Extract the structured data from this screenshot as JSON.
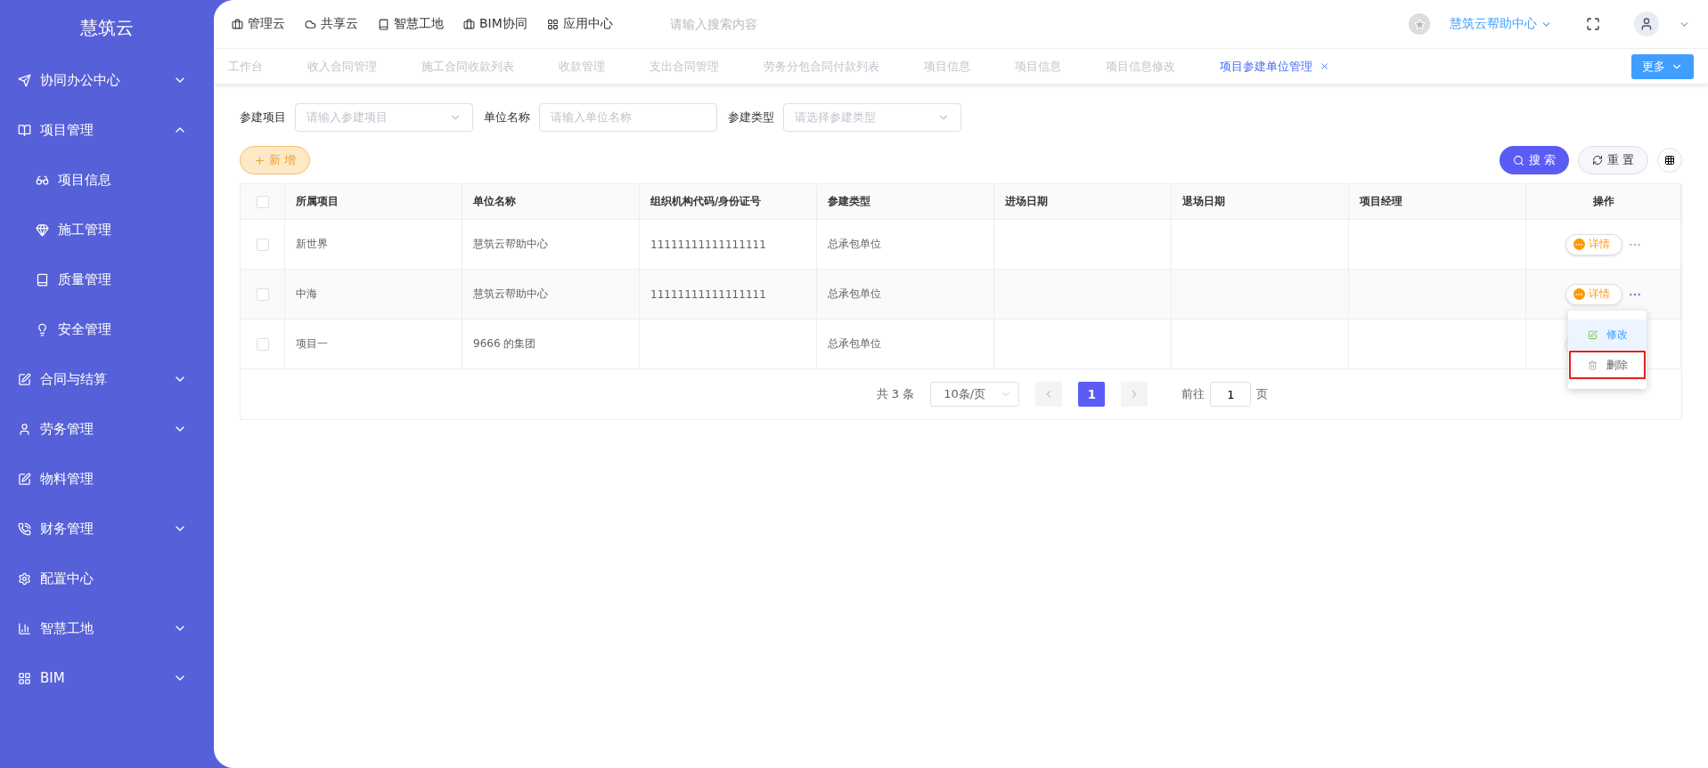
{
  "brand": "慧筑云",
  "sidebar": {
    "items": [
      {
        "label": "协同办公中心",
        "expanded": false
      },
      {
        "label": "项目管理",
        "expanded": true,
        "children": [
          {
            "label": "项目信息"
          },
          {
            "label": "施工管理"
          },
          {
            "label": "质量管理"
          },
          {
            "label": "安全管理"
          }
        ]
      },
      {
        "label": "合同与结算",
        "expanded": false
      },
      {
        "label": "劳务管理",
        "expanded": false
      },
      {
        "label": "物料管理"
      },
      {
        "label": "财务管理",
        "expanded": false
      },
      {
        "label": "配置中心"
      },
      {
        "label": "智慧工地",
        "expanded": false
      },
      {
        "label": "BIM",
        "expanded": false
      }
    ]
  },
  "top_nav": {
    "links": [
      "管理云",
      "共享云",
      "智慧工地",
      "BIM协同",
      "应用中心"
    ],
    "search": {
      "placeholder": "请输入搜索内容"
    },
    "help": "慧筑云帮助中心"
  },
  "tabs": [
    {
      "label": "工作台",
      "selected": false
    },
    {
      "label": "收入合同管理",
      "selected": false
    },
    {
      "label": "施工合同收款列表",
      "selected": false
    },
    {
      "label": "收款管理",
      "selected": false
    },
    {
      "label": "支出合同管理",
      "selected": false
    },
    {
      "label": "劳务分包合同付款列表",
      "selected": false
    },
    {
      "label": "项目信息",
      "selected": false
    },
    {
      "label": "项目信息",
      "selected": false
    },
    {
      "label": "项目信息修改",
      "selected": false
    },
    {
      "label": "项目参建单位管理",
      "selected": true,
      "closable": true
    }
  ],
  "more_button": "更多",
  "filters": [
    {
      "label": "参建项目",
      "placeholder": "请输入参建项目",
      "kind": "select"
    },
    {
      "label": "单位名称",
      "placeholder": "请输入单位名称",
      "kind": "input"
    },
    {
      "label": "参建类型",
      "placeholder": "请选择参建类型",
      "kind": "select"
    }
  ],
  "add_button": "新 增",
  "search_button": "搜 索",
  "reset_button": "重 置",
  "table": {
    "select_all": {
      "checked": false
    },
    "columns": [
      "所属项目",
      "单位名称",
      "组织机构代码/身份证号",
      "参建类型",
      "进场日期",
      "退场日期",
      "项目经理",
      "操作"
    ],
    "rows": [
      {
        "checked": false,
        "cells": [
          "新世界",
          "慧筑云帮助中心",
          "11111111111111111",
          "总承包单位",
          "",
          "",
          ""
        ],
        "detail": "详情",
        "menu_open": false
      },
      {
        "checked": false,
        "cells": [
          "中海",
          "慧筑云帮助中心",
          "11111111111111111",
          "总承包单位",
          "",
          "",
          ""
        ],
        "detail": "详情",
        "menu_open": true
      },
      {
        "checked": false,
        "cells": [
          "项目一",
          "9666 的集团",
          "",
          "总承包单位",
          "",
          "",
          ""
        ]
      }
    ]
  },
  "row_menu": [
    {
      "label": "修改",
      "selected": true,
      "outlined": false
    },
    {
      "label": "删除",
      "selected": false,
      "outlined": true
    }
  ],
  "pagination": {
    "total": "共 3 条",
    "page_size": "10条/页",
    "pages": [
      {
        "label": "1",
        "selected": true
      }
    ],
    "goto_prefix": "前往",
    "goto_value": "1",
    "goto_suffix": "页"
  }
}
